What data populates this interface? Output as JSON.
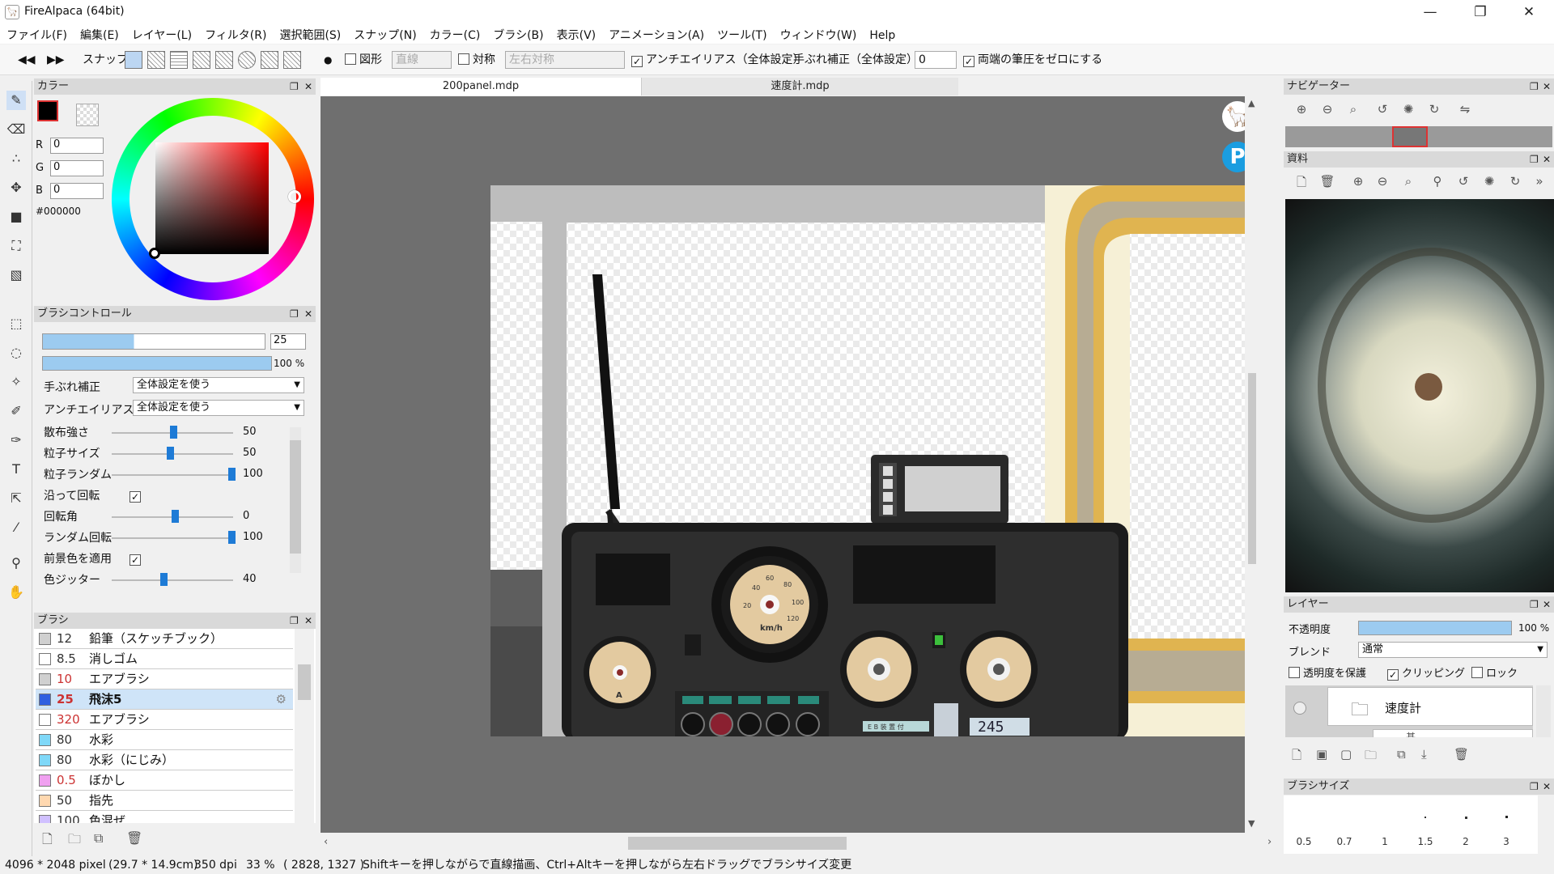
{
  "app": {
    "title": "FireAlpaca (64bit)"
  },
  "menu": [
    "ファイル(F)",
    "編集(E)",
    "レイヤー(L)",
    "フィルタ(R)",
    "選択範囲(S)",
    "スナップ(N)",
    "カラー(C)",
    "ブラシ(B)",
    "表示(V)",
    "アニメーション(A)",
    "ツール(T)",
    "ウィンドウ(W)",
    "Help"
  ],
  "toolbar": {
    "snap_label": "スナップ",
    "shape_label": "図形",
    "shape_value": "直線",
    "symmetry_label": "対称",
    "symmetry_value": "左右対称",
    "antialias_label": "アンチエイリアス（全体設定）",
    "stabilizer_label": "手ぶれ補正（全体設定）",
    "stabilizer_value": "0",
    "pressure_label": "両端の筆圧をゼロにする"
  },
  "color_panel": {
    "title": "カラー",
    "r_label": "R",
    "r": "0",
    "g_label": "G",
    "g": "0",
    "b_label": "B",
    "b": "0",
    "hex": "#000000"
  },
  "brush_control": {
    "title": "ブラシコントロール",
    "size": "25",
    "opacity": "100 %",
    "stabilizer_label": "手ぶれ補正",
    "stabilizer_value": "全体設定を使う",
    "antialias_label": "アンチエイリアス",
    "antialias_value": "全体設定を使う",
    "params": [
      {
        "label": "散布強さ",
        "value": "50"
      },
      {
        "label": "粒子サイズ",
        "value": "50"
      },
      {
        "label": "粒子ランダム",
        "value": "100"
      },
      {
        "label": "沿って回転",
        "value": ""
      },
      {
        "label": "回転角",
        "value": "0"
      },
      {
        "label": "ランダム回転",
        "value": "100"
      },
      {
        "label": "前景色を適用",
        "value": ""
      },
      {
        "label": "色ジッター",
        "value": "40"
      }
    ]
  },
  "brush_list": {
    "title": "ブラシ",
    "items": [
      {
        "size": "12",
        "name": "鉛筆（スケッチブック）",
        "color": "#d0d0d0"
      },
      {
        "size": "8.5",
        "name": "消しゴム",
        "color": "#ffffff"
      },
      {
        "size": "10",
        "name": "エアブラシ",
        "color": "#d0d0d0"
      },
      {
        "size": "25",
        "name": "飛沫5",
        "color": "#2f5fe0"
      },
      {
        "size": "320",
        "name": "エアブラシ",
        "color": "#ffffff"
      },
      {
        "size": "80",
        "name": "水彩",
        "color": "#7fd8f8"
      },
      {
        "size": "80",
        "name": "水彩（にじみ）",
        "color": "#7fd8f8"
      },
      {
        "size": "0.5",
        "name": "ぼかし",
        "color": "#f0a0f0"
      },
      {
        "size": "50",
        "name": "指先",
        "color": "#ffd8b0"
      },
      {
        "size": "100",
        "name": "色混ぜ",
        "color": "#d0c0ff"
      }
    ]
  },
  "tabs": [
    "200panel.mdp",
    "速度計.mdp"
  ],
  "navigator": {
    "title": "ナビゲーター"
  },
  "material": {
    "title": "資料"
  },
  "layer_panel": {
    "title": "レイヤー",
    "opacity_label": "不透明度",
    "opacity_value": "100 %",
    "blend_label": "ブレンド",
    "blend_value": "通常",
    "protect_label": "透明度を保護",
    "clip_label": "クリッピング",
    "lock_label": "ロック",
    "layer_name": "速度計",
    "sub_layer": "基"
  },
  "brush_size": {
    "title": "ブラシサイズ",
    "sizes": [
      "0.5",
      "0.7",
      "1",
      "1.5",
      "2",
      "3"
    ]
  },
  "status": {
    "dims": "4096 * 2048 pixel",
    "cm": "(29.7 * 14.9cm)",
    "dpi": "350 dpi",
    "zoom": "33 %",
    "coords": "( 2828, 1327 )",
    "hint": "Shiftキーを押しながらで直線描画、Ctrl+Altキーを押しながら左右ドラッグでブラシサイズ変更"
  },
  "artwork": {
    "speedometer_unit": "km/h",
    "speed_ticks": [
      "20",
      "40",
      "60",
      "80",
      "100",
      "120"
    ],
    "counter": "245",
    "small_label": "E B 装 置 付",
    "ammeter_unit": "A"
  }
}
